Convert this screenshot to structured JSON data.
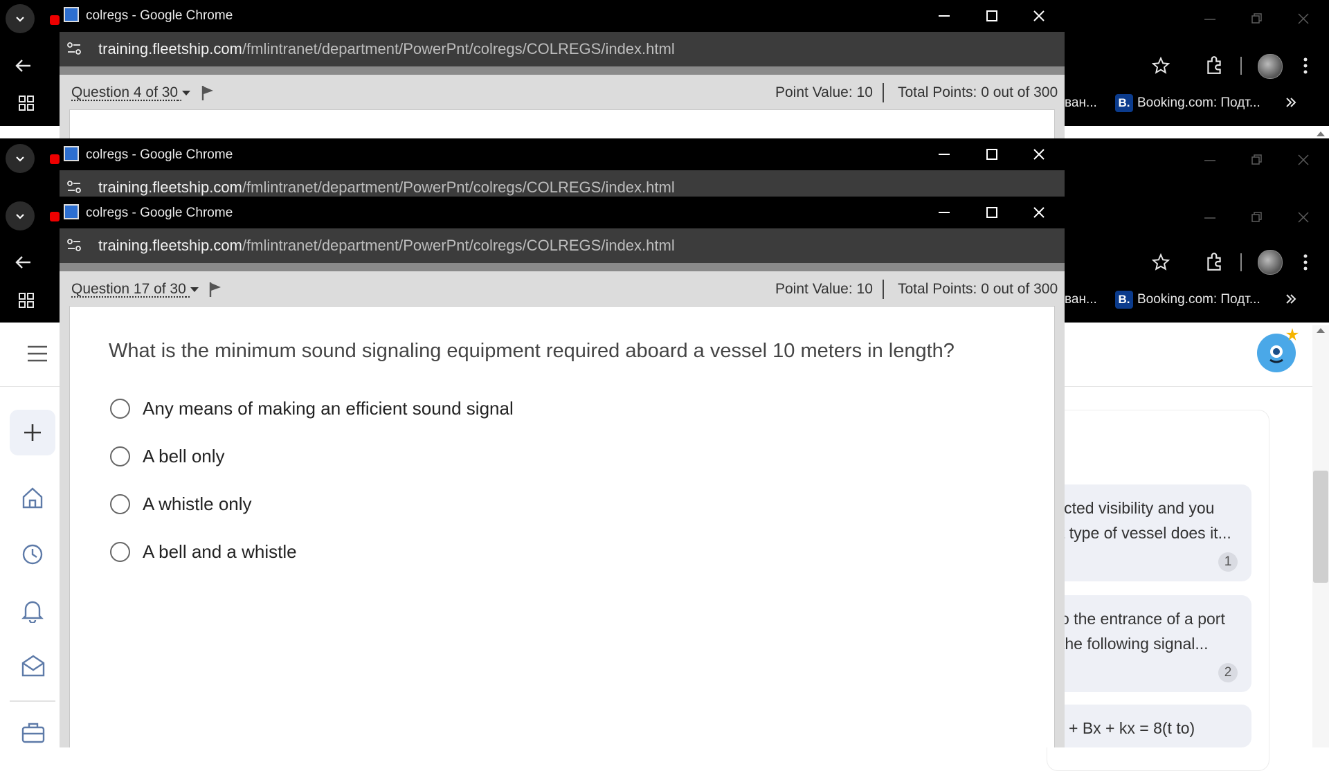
{
  "popup_windows": [
    {
      "title": "colregs - Google Chrome",
      "url_host": "training.fleetship.com",
      "url_path": "/fmlintranet/department/PowerPnt/colregs/COLREGS/index.html"
    },
    {
      "title": "colregs - Google Chrome",
      "url_host": "training.fleetship.com",
      "url_path": "/fmlintranet/department/PowerPnt/colregs/COLREGS/index.html"
    },
    {
      "title": "colregs - Google Chrome",
      "url_host": "training.fleetship.com",
      "url_path": "/fmlintranet/department/PowerPnt/colregs/COLREGS/index.html"
    }
  ],
  "quiz_top": {
    "question_number": "Question 4 of 30",
    "point_value": "Point Value: 10",
    "total_points": "Total Points: 0 out of 300"
  },
  "quiz_main": {
    "question_number": "Question 17 of 30",
    "point_value": "Point Value: 10",
    "total_points": "Total Points: 0 out of 300",
    "question": "What is the minimum sound signaling equipment required aboard a vessel 10 meters in length?",
    "options": [
      "Any means of making an efficient sound signal",
      "A bell only",
      "A whistle only",
      "A bell and a whistle"
    ]
  },
  "bookmarks": {
    "partial": "ван...",
    "booking": "Booking.com: Подт...",
    "booking_icon": "B."
  },
  "chat_history": [
    {
      "line1": "icted visibility and you",
      "line2": "t type of vessel does it...",
      "count": "1"
    },
    {
      "line1": "o the entrance of a port",
      "line2": "the following signal...",
      "count": "2"
    },
    {
      "line1": "+ Bx + kx = 8(t to)",
      "line2": "",
      "count": ""
    }
  ],
  "icons": [
    "chevron-down-icon",
    "back-arrow-icon",
    "apps-grid-icon",
    "star-icon",
    "extensions-icon",
    "more-icon",
    "minimize-icon",
    "maximize-icon",
    "close-icon",
    "site-info-icon",
    "flag-icon",
    "menu-icon",
    "plus-icon",
    "home-icon",
    "history-icon",
    "bell-icon",
    "mail-icon",
    "briefcase-icon",
    "mascot-icon"
  ]
}
